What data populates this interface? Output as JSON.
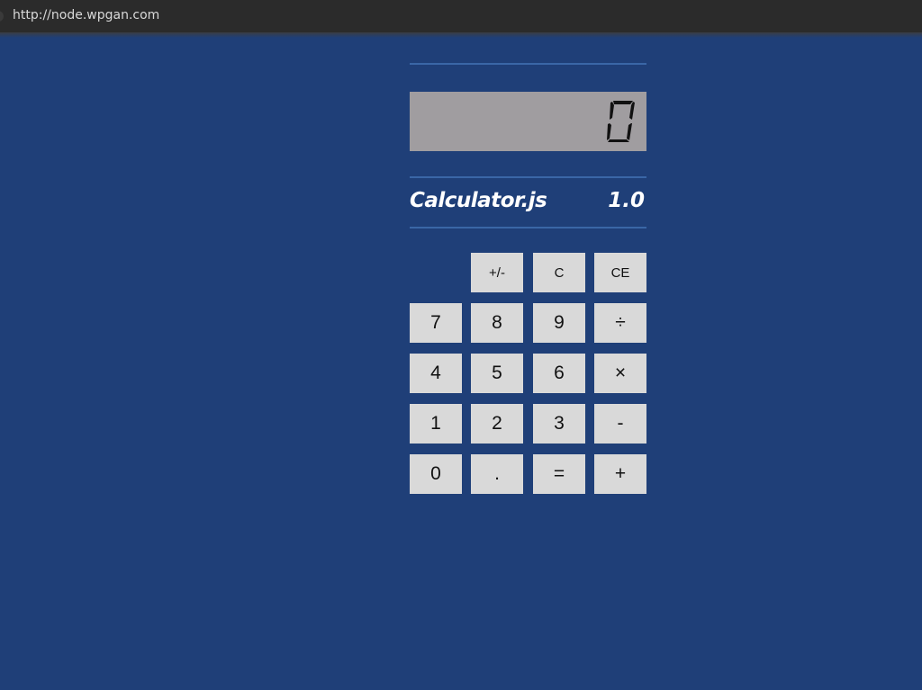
{
  "browser": {
    "url": "http://node.wpgan.com"
  },
  "calculator": {
    "display_value": "0",
    "brand": "Calculator.js",
    "version": "1.0",
    "keys": {
      "sign": "+/-",
      "clear": "C",
      "clear_entry": "CE",
      "seven": "7",
      "eight": "8",
      "nine": "9",
      "divide": "÷",
      "four": "4",
      "five": "5",
      "six": "6",
      "multiply": "×",
      "one": "1",
      "two": "2",
      "three": "3",
      "subtract": "-",
      "zero": "0",
      "decimal": ".",
      "equals": "=",
      "add": "+"
    }
  },
  "colors": {
    "background": "#1f3f78",
    "display": "#a09da0",
    "key": "#d9d9d9",
    "rule": "#3a66a6"
  }
}
